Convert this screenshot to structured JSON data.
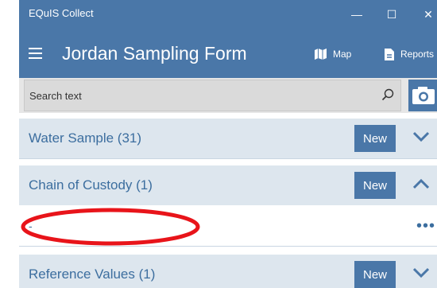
{
  "app": {
    "window_title": "EQuIS Collect",
    "window_controls": [
      "minimize",
      "maximize",
      "close"
    ]
  },
  "header": {
    "title": "Jordan Sampling Form",
    "map_label": "Map",
    "reports_label": "Reports"
  },
  "search": {
    "placeholder": "Search text"
  },
  "sections": [
    {
      "label": "Water Sample (31)",
      "new_label": "New",
      "expanded": false
    },
    {
      "label": "Chain of Custody (1)",
      "new_label": "New",
      "expanded": true,
      "items": [
        {
          "value": "-",
          "more": "•••"
        }
      ]
    },
    {
      "label": "Reference Values (1)",
      "new_label": "New",
      "expanded": false
    }
  ],
  "colors": {
    "accent": "#4a77a8",
    "section_bg": "#dde6ee",
    "section_text": "#3c6e9f",
    "annotation": "#e8141a"
  },
  "icons": {
    "menu": "hamburger-icon",
    "map": "map-icon",
    "reports": "document-icon",
    "search": "search-icon",
    "camera": "camera-icon",
    "expand": "chevron-down-icon",
    "collapse": "chevron-up-icon"
  }
}
